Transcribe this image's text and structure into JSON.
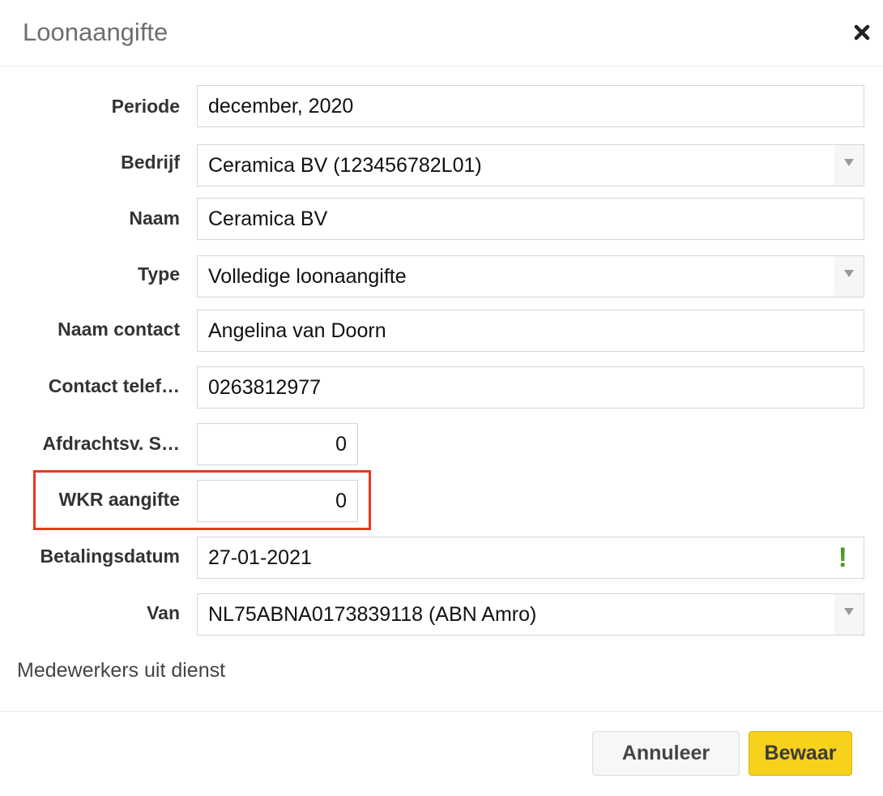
{
  "dialog": {
    "title": "Loonaangifte",
    "close_icon": "close-icon"
  },
  "form": {
    "periode": {
      "label": "Periode",
      "value": "december, 2020"
    },
    "bedrijf": {
      "label": "Bedrijf",
      "value": "Ceramica BV (123456782L01)"
    },
    "naam": {
      "label": "Naam",
      "value": "Ceramica BV"
    },
    "type": {
      "label": "Type",
      "value": "Volledige loonaangifte"
    },
    "naam_contact": {
      "label": "Naam contact",
      "value": "Angelina van Doorn"
    },
    "contact_telefoon": {
      "label": "Contact telef…",
      "value": "0263812977"
    },
    "afdrachtsv": {
      "label": "Afdrachtsv. S…",
      "value": "0"
    },
    "wkr_aangifte": {
      "label": "WKR aangifte",
      "value": "0"
    },
    "betalingsdatum": {
      "label": "Betalingsdatum",
      "value": "27-01-2021",
      "warning": "!"
    },
    "van": {
      "label": "Van",
      "value": "NL75ABNA0173839118 (ABN Amro)"
    }
  },
  "section": {
    "medewerkers_uit_dienst": "Medewerkers uit dienst"
  },
  "footer": {
    "cancel_label": "Annuleer",
    "save_label": "Bewaar"
  },
  "colors": {
    "highlight": "#e8391e",
    "save_button": "#f7d21d",
    "warning": "#4d9a1e"
  }
}
